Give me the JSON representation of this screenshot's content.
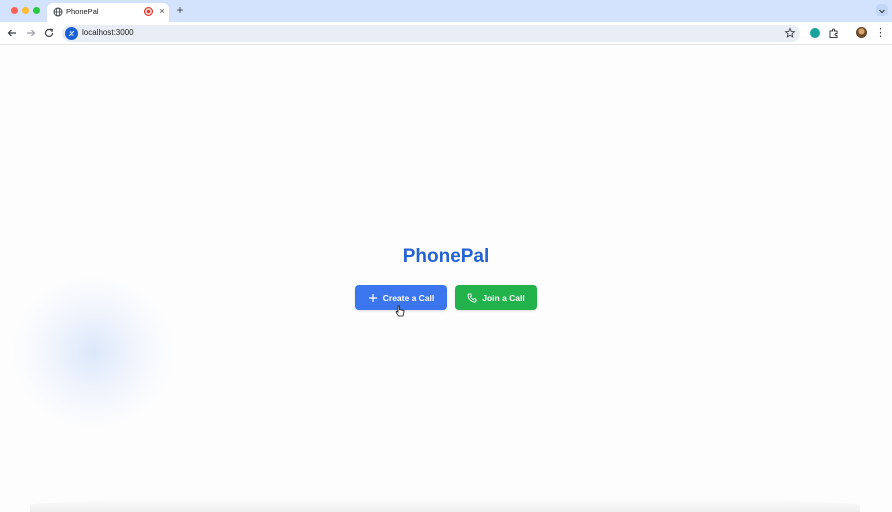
{
  "browser": {
    "tab": {
      "title": "PhonePal",
      "close_glyph": "×",
      "favicon_icon": "globe-icon",
      "recording_indicator": "record-icon"
    },
    "new_tab_glyph": "+",
    "url": "localhost:3000",
    "menu_glyph": "⋮"
  },
  "page": {
    "title": "PhonePal",
    "buttons": {
      "create": {
        "label": "Create a Call",
        "icon": "plus-icon",
        "color": "#3b76ee"
      },
      "join": {
        "label": "Join a Call",
        "icon": "phone-icon",
        "color": "#22b24c"
      }
    },
    "title_color": "#2563d3"
  }
}
